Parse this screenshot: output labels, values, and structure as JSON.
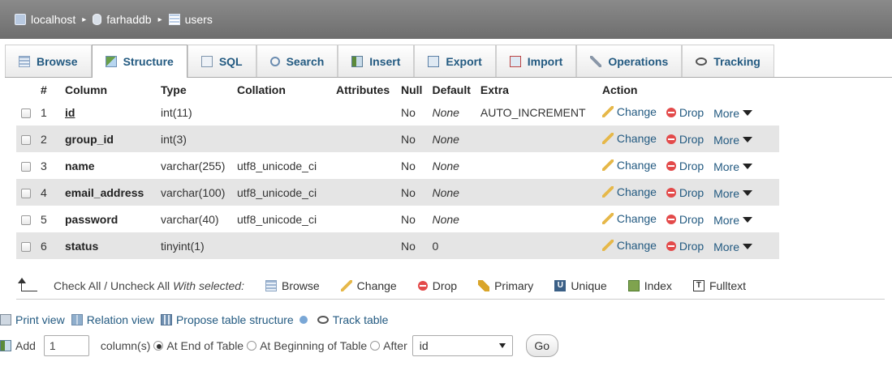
{
  "breadcrumb": {
    "server": "localhost",
    "database": "farhaddb",
    "table": "users",
    "separator": "▸"
  },
  "tabs": [
    {
      "label": "Browse",
      "icon": "browse-icon",
      "active": false
    },
    {
      "label": "Structure",
      "icon": "structure-icon",
      "active": true
    },
    {
      "label": "SQL",
      "icon": "sql-icon",
      "active": false
    },
    {
      "label": "Search",
      "icon": "search-icon",
      "active": false
    },
    {
      "label": "Insert",
      "icon": "insert-icon",
      "active": false
    },
    {
      "label": "Export",
      "icon": "export-icon",
      "active": false
    },
    {
      "label": "Import",
      "icon": "import-icon",
      "active": false
    },
    {
      "label": "Operations",
      "icon": "operations-icon",
      "active": false
    },
    {
      "label": "Tracking",
      "icon": "tracking-icon",
      "active": false
    }
  ],
  "table": {
    "headers": {
      "num": "#",
      "column": "Column",
      "type": "Type",
      "collation": "Collation",
      "attributes": "Attributes",
      "null": "Null",
      "default": "Default",
      "extra": "Extra",
      "action": "Action"
    },
    "rows": [
      {
        "num": "1",
        "name": "id",
        "type": "int(11)",
        "collation": "",
        "attributes": "",
        "null": "No",
        "default": "None",
        "extra": "AUTO_INCREMENT"
      },
      {
        "num": "2",
        "name": "group_id",
        "type": "int(3)",
        "collation": "",
        "attributes": "",
        "null": "No",
        "default": "None",
        "extra": ""
      },
      {
        "num": "3",
        "name": "name",
        "type": "varchar(255)",
        "collation": "utf8_unicode_ci",
        "attributes": "",
        "null": "No",
        "default": "None",
        "extra": ""
      },
      {
        "num": "4",
        "name": "email_address",
        "type": "varchar(100)",
        "collation": "utf8_unicode_ci",
        "attributes": "",
        "null": "No",
        "default": "None",
        "extra": ""
      },
      {
        "num": "5",
        "name": "password",
        "type": "varchar(40)",
        "collation": "utf8_unicode_ci",
        "attributes": "",
        "null": "No",
        "default": "None",
        "extra": ""
      },
      {
        "num": "6",
        "name": "status",
        "type": "tinyint(1)",
        "collation": "",
        "attributes": "",
        "null": "No",
        "default": "0",
        "extra": ""
      }
    ],
    "actions": {
      "change": "Change",
      "drop": "Drop",
      "more": "More"
    }
  },
  "with_selected": {
    "check_all": "Check All / Uncheck All",
    "with_selected": "With selected:",
    "browse": "Browse",
    "change": "Change",
    "drop": "Drop",
    "primary": "Primary",
    "unique": "Unique",
    "index": "Index",
    "fulltext": "Fulltext",
    "unique_glyph": "U",
    "fulltext_glyph": "T"
  },
  "links": {
    "print_view": "Print view",
    "relation_view": "Relation view",
    "propose_structure": "Propose table structure",
    "track_table": "Track table"
  },
  "add_row": {
    "add_label": "Add",
    "count_value": "1",
    "columns_label": "column(s)",
    "at_end": "At End of Table",
    "at_beginning": "At Beginning of Table",
    "after": "After",
    "after_value": "id",
    "go": "Go"
  }
}
